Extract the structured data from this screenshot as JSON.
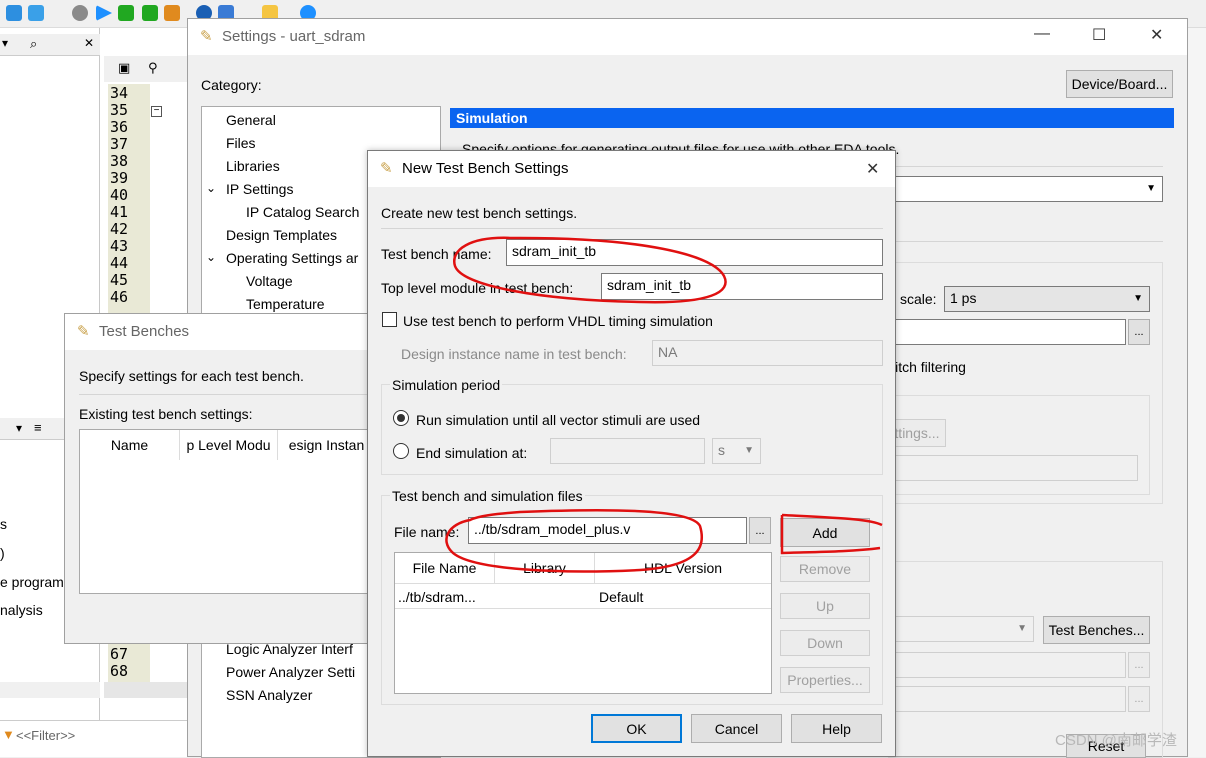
{
  "ide": {
    "line_numbers_top": [
      "34",
      "35",
      "36",
      "37",
      "38",
      "39",
      "40",
      "41",
      "42",
      "43",
      "44",
      "45",
      "46"
    ],
    "line_numbers_bottom": [
      "67",
      "68"
    ],
    "left_labels": [
      "s",
      ")",
      "e program",
      "nalysis"
    ],
    "filter": "<<Filter>>",
    "toolbar_icon_names": [
      "compile",
      "stop",
      "play",
      "check",
      "route",
      "program"
    ]
  },
  "settings": {
    "title": "Settings - uart_sdram",
    "category_label": "Category:",
    "device_board_button": "Device/Board...",
    "categories": [
      "General",
      "Files",
      "Libraries",
      "IP Settings",
      "IP Catalog Search",
      "Design Templates",
      "Operating Settings ar",
      "Voltage",
      "Temperature"
    ],
    "categories_bottom": [
      "Logic Analyzer Interf",
      "Power Analyzer Setti",
      "SSN Analyzer"
    ],
    "section_title": "Simulation",
    "section_desc": "Specify options for generating output files for use with other EDA tools.",
    "scale_label": "scale:",
    "scale_value": "1 ps",
    "glitch_label": "litch filtering",
    "settings_partial_button": "ttings...",
    "test_benches_button": "Test Benches...",
    "reset_button": "Reset",
    "watermark": "CSDN @南邮学渣"
  },
  "test_benches": {
    "title": "Test Benches",
    "description": "Specify settings for each test bench.",
    "existing_label": "Existing test bench settings:",
    "columns": [
      "Name",
      "p Level Modu",
      "esign Instan"
    ]
  },
  "new_tb": {
    "title": "New Test Bench Settings",
    "create_label": "Create new test bench settings.",
    "tb_name_label": "Test bench name:",
    "tb_name_value": "sdram_init_tb",
    "top_module_label": "Top level module in test bench:",
    "top_module_value": "sdram_init_tb",
    "vhdl_checkbox_label": "Use test bench to perform VHDL timing simulation",
    "design_instance_label": "Design instance name in test bench:",
    "design_instance_value": "NA",
    "sim_period_title": "Simulation period",
    "run_until_label": "Run simulation until all vector stimuli are used",
    "end_at_label": "End simulation at:",
    "end_unit": "s",
    "files_group_title": "Test bench and simulation files",
    "file_name_label": "File name:",
    "file_name_value": "../tb/sdram_model_plus.v",
    "browse_label": "...",
    "columns": [
      "File Name",
      "Library",
      "HDL Version"
    ],
    "rows": [
      {
        "file": "../tb/sdram...",
        "library": "",
        "hdl": "Default"
      }
    ],
    "add_button": "Add",
    "remove_button": "Remove",
    "up_button": "Up",
    "down_button": "Down",
    "properties_button": "Properties...",
    "ok_button": "OK",
    "cancel_button": "Cancel",
    "help_button": "Help",
    "annotation_color": "#e01010"
  }
}
